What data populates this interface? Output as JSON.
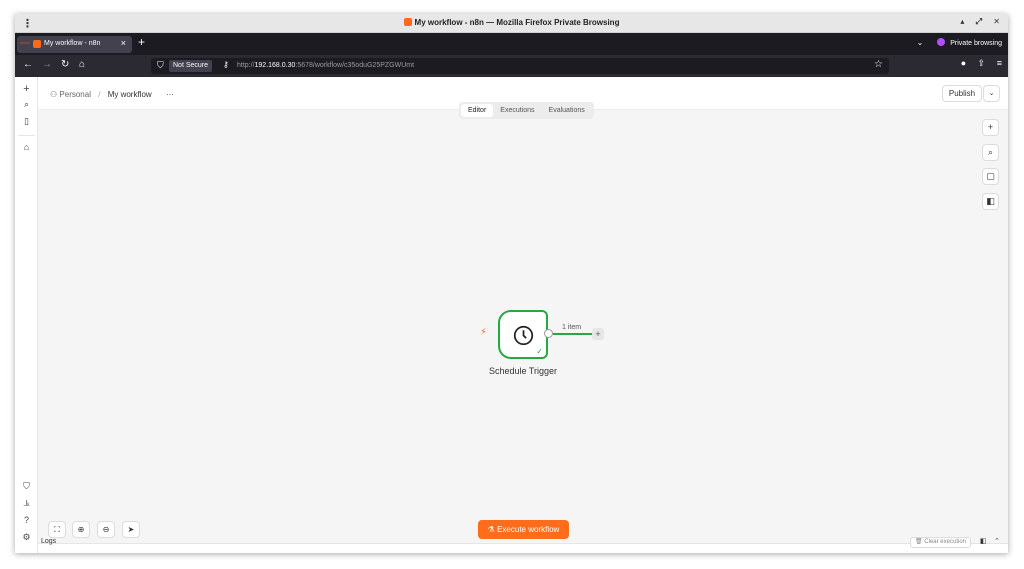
{
  "window": {
    "title": "My workflow - n8n — Mozilla Firefox Private Browsing",
    "menu_glyph": "⋮",
    "controls": [
      "▴",
      "⤢",
      "✕"
    ]
  },
  "tabs": {
    "active_label": "My workflow - n8n",
    "close": "×",
    "new_tab": "+",
    "overflow": "⌄",
    "private_label": "Private browsing"
  },
  "nav": {
    "back": "←",
    "forward": "→",
    "reload": "↻",
    "home": "⌂",
    "security_label": "Not Secure",
    "url_prefix": "http://",
    "url_host": "192.168.0.30",
    "url_rest": ":5678/workflow/c35oduG25PZGWUmt",
    "bookmark": "☆",
    "right_icons": [
      "●",
      "⇪",
      "≡"
    ]
  },
  "sidebar": {
    "top_icons": [
      "+",
      "⌕",
      "▯",
      "⌂"
    ],
    "bottom_icons": [
      "⛉",
      "⫡",
      "?",
      "⚙"
    ]
  },
  "header": {
    "project_icon": "⚇",
    "project": "Personal",
    "separator": "/",
    "workflow_name": "My workflow",
    "more": "···",
    "publish_label": "Publish",
    "publish_dropdown": "⌄"
  },
  "modes": [
    "Editor",
    "Executions",
    "Evaluations"
  ],
  "active_mode": "Editor",
  "right_toolbar": [
    "+",
    "⌕",
    "▢",
    "◧"
  ],
  "node": {
    "label": "Schedule Trigger",
    "trigger_icon": "⚡",
    "status_icon": "✓",
    "output_label": "1 item",
    "add_label": "+"
  },
  "bottom_toolbar": [
    "⛶",
    "⊕",
    "⊖",
    "➤"
  ],
  "execute_button": "Execute workflow",
  "execute_icon": "⚗",
  "logs": {
    "label": "Logs",
    "clear_label": "Clear execution",
    "clear_icon": "🗑",
    "panel_icon": "◧",
    "chevron": "⌃"
  },
  "colors": {
    "accent": "#ff6d1a",
    "success": "#29a744"
  }
}
